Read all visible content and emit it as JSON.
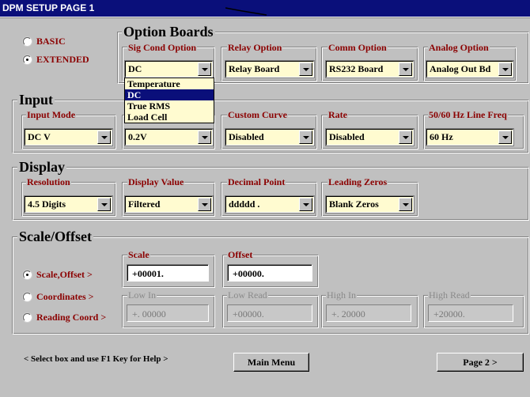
{
  "title": "DPM SETUP PAGE 1",
  "mode": {
    "basic_label": "BASIC",
    "extended_label": "EXTENDED",
    "selected": "EXTENDED"
  },
  "option_boards": {
    "title": "Option Boards",
    "sig_cond": {
      "label": "Sig Cond Option",
      "value": "DC"
    },
    "relay": {
      "label": "Relay Option",
      "value": "Relay Board"
    },
    "comm": {
      "label": "Comm Option",
      "value": "RS232 Board"
    },
    "analog": {
      "label": "Analog Option",
      "value": "Analog Out Bd"
    },
    "sig_cond_dropdown": [
      "Temperature",
      "DC",
      "True RMS",
      "Load Cell"
    ],
    "sig_cond_dropdown_selected": "DC"
  },
  "input": {
    "title": "Input",
    "input_mode": {
      "label": "Input Mode",
      "value": "DC V"
    },
    "range": {
      "value": "0.2V"
    },
    "custom_curve": {
      "label": "Custom Curve",
      "value": "Disabled"
    },
    "rate": {
      "label": "Rate",
      "value": "Disabled"
    },
    "line_freq": {
      "label": "50/60 Hz Line Freq",
      "value": "60 Hz"
    }
  },
  "display": {
    "title": "Display",
    "resolution": {
      "label": "Resolution",
      "value": "4.5 Digits"
    },
    "display_value": {
      "label": "Display Value",
      "value": "Filtered"
    },
    "decimal_point": {
      "label": "Decimal Point",
      "value": "ddddd ."
    },
    "leading_zeros": {
      "label": "Leading Zeros",
      "value": "Blank Zeros"
    }
  },
  "scale_offset": {
    "title": "Scale/Offset",
    "radio_scale_offset": "Scale,Offset >",
    "radio_coordinates": "Coordinates >",
    "radio_reading_coord": "Reading Coord >",
    "selected": "Scale,Offset >",
    "scale": {
      "label": "Scale",
      "value": "+00001."
    },
    "offset": {
      "label": "Offset",
      "value": "+00000."
    },
    "low_in": {
      "label": "Low In",
      "value": "+. 00000"
    },
    "low_read": {
      "label": "Low Read",
      "value": "+00000."
    },
    "high_in": {
      "label": "High In",
      "value": "+. 20000"
    },
    "high_read": {
      "label": "High Read",
      "value": "+20000."
    }
  },
  "footer": {
    "help_text": "< Select box and use F1 Key for Help >",
    "main_menu": "Main Menu",
    "page2": "Page 2   >"
  },
  "colors": {
    "titlebar": "#0a0f7a",
    "label_red": "#8b0000",
    "combo_bg": "#fffbd0",
    "window_bg": "#c0c0c0"
  }
}
